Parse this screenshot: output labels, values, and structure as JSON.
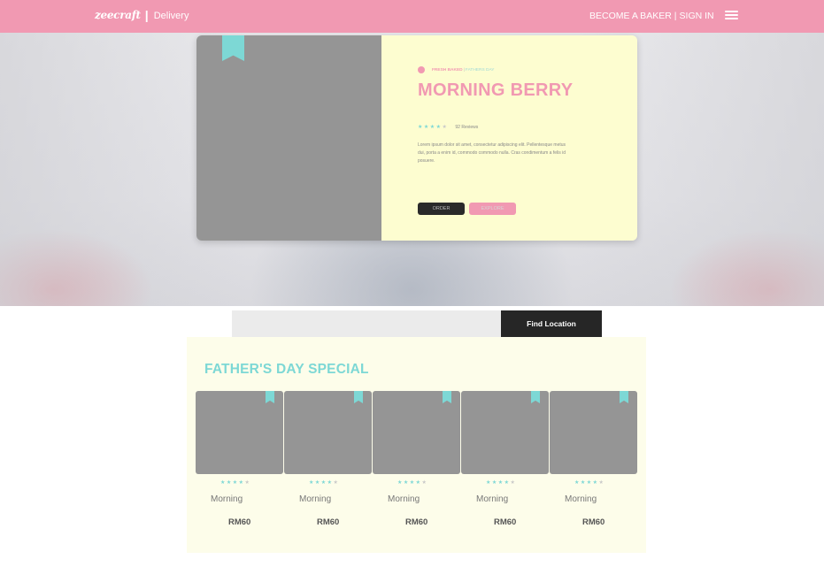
{
  "header": {
    "brand_logo": "zeecraft",
    "brand_separator": "|",
    "brand_sub": "Delivery",
    "become_baker_label": "BECOME A BAKER",
    "links_separator": "|",
    "sign_in_label": "SIGN IN",
    "menu_icon": "hamburger-menu-icon",
    "background_color": "#f199b2"
  },
  "hero": {
    "tag_icon": "cupcake-icon",
    "tag_primary": "FRESH BAKED",
    "tag_separator": "|",
    "tag_secondary": "FATHERS DAY",
    "title": "MORNING BERRY",
    "rating": {
      "stars_filled": 4,
      "stars_total": 5,
      "star_icon": "star-icon"
    },
    "review_count": "92 Reviews",
    "description": "Lorem ipsum dolor sit amet, consectetur adipiscing elit. Pellentesque metus dui, porta a enim id, commodo commodo nulla. Cras condimentum a felis id posuere.",
    "order_label": "ORDER",
    "explore_label": "EXPLORE",
    "bookmark_icon": "bookmark-ribbon-icon",
    "accent_color": "#7dd8d5",
    "pink_color": "#f199b2",
    "card_background": "#fdfdd0"
  },
  "location": {
    "input_value": "",
    "input_placeholder": "",
    "button_label": "Find Location"
  },
  "special": {
    "title": "FATHER'S DAY SPECIAL",
    "products": [
      {
        "name": "Morning",
        "price": "RM60",
        "stars_filled": 4,
        "stars_total": 5
      },
      {
        "name": "Morning",
        "price": "RM60",
        "stars_filled": 4,
        "stars_total": 5
      },
      {
        "name": "Morning",
        "price": "RM60",
        "stars_filled": 4,
        "stars_total": 5
      },
      {
        "name": "Morning",
        "price": "RM60",
        "stars_filled": 4,
        "stars_total": 5
      },
      {
        "name": "Morning",
        "price": "RM60",
        "stars_filled": 4,
        "stars_total": 5
      }
    ]
  }
}
